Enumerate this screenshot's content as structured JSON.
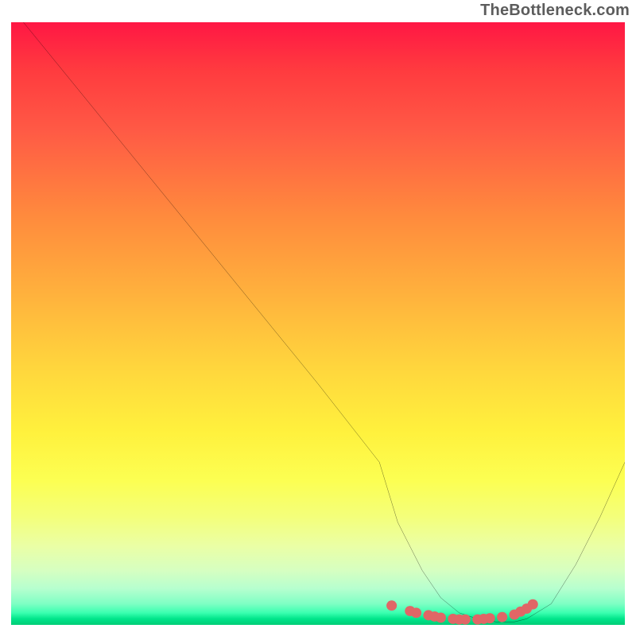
{
  "attribution": "TheBottleneck.com",
  "chart_data": {
    "type": "line",
    "title": "",
    "xlabel": "",
    "ylabel": "",
    "xlim": [
      0,
      100
    ],
    "ylim": [
      0,
      100
    ],
    "series": [
      {
        "name": "curve",
        "x": [
          2,
          10,
          20,
          30,
          40,
          50,
          60,
          63,
          67,
          70,
          73,
          76,
          79,
          82,
          84,
          88,
          92,
          96,
          100
        ],
        "y": [
          100,
          90,
          77.5,
          65,
          52.5,
          40,
          27,
          17,
          9,
          4.5,
          2,
          1,
          0.5,
          0.5,
          1,
          3.5,
          10,
          18,
          27
        ]
      },
      {
        "name": "valley-dots",
        "x": [
          62,
          65,
          66,
          68,
          69,
          70,
          72,
          73,
          74,
          76,
          77,
          78,
          80,
          82,
          83,
          84,
          85
        ],
        "y": [
          3.2,
          2.3,
          2.0,
          1.6,
          1.4,
          1.2,
          1.0,
          0.9,
          0.9,
          0.9,
          1.0,
          1.1,
          1.3,
          1.7,
          2.2,
          2.7,
          3.4
        ]
      }
    ],
    "gradient_stops": [
      {
        "pos": 0,
        "color": "#ff1744"
      },
      {
        "pos": 8,
        "color": "#ff3b3f"
      },
      {
        "pos": 18,
        "color": "#ff5a45"
      },
      {
        "pos": 32,
        "color": "#ff8a3d"
      },
      {
        "pos": 45,
        "color": "#ffb13d"
      },
      {
        "pos": 57,
        "color": "#ffd53d"
      },
      {
        "pos": 68,
        "color": "#fff13d"
      },
      {
        "pos": 76,
        "color": "#fcff52"
      },
      {
        "pos": 82,
        "color": "#f4ff7a"
      },
      {
        "pos": 87,
        "color": "#eaffa6"
      },
      {
        "pos": 91,
        "color": "#d6ffc1"
      },
      {
        "pos": 94,
        "color": "#b6ffcf"
      },
      {
        "pos": 96.5,
        "color": "#7effc4"
      },
      {
        "pos": 98,
        "color": "#3bffb0"
      },
      {
        "pos": 99,
        "color": "#00e58a"
      },
      {
        "pos": 100,
        "color": "#00cc76"
      }
    ],
    "dot_color": "#e06666",
    "curve_color": "#000000"
  }
}
